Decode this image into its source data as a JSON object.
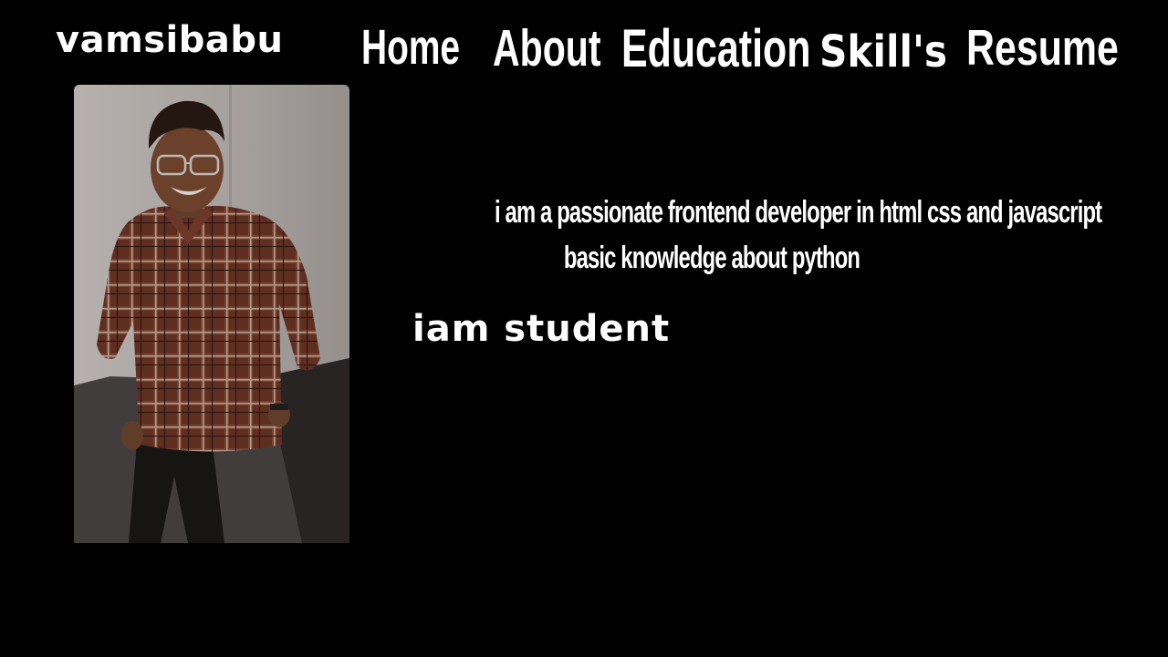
{
  "header": {
    "brand": "vamsibabu",
    "nav": [
      {
        "label": "Home"
      },
      {
        "label": "About"
      },
      {
        "label": "Education"
      },
      {
        "label": "Skill's"
      },
      {
        "label": "Resume"
      }
    ]
  },
  "main": {
    "intro_line_1": "i am a passionate frontend developer in html css and javascript",
    "intro_line_2": "basic knowledge about python",
    "status": "iam student"
  },
  "colors": {
    "background": "#000000",
    "text": "#ffffff"
  }
}
